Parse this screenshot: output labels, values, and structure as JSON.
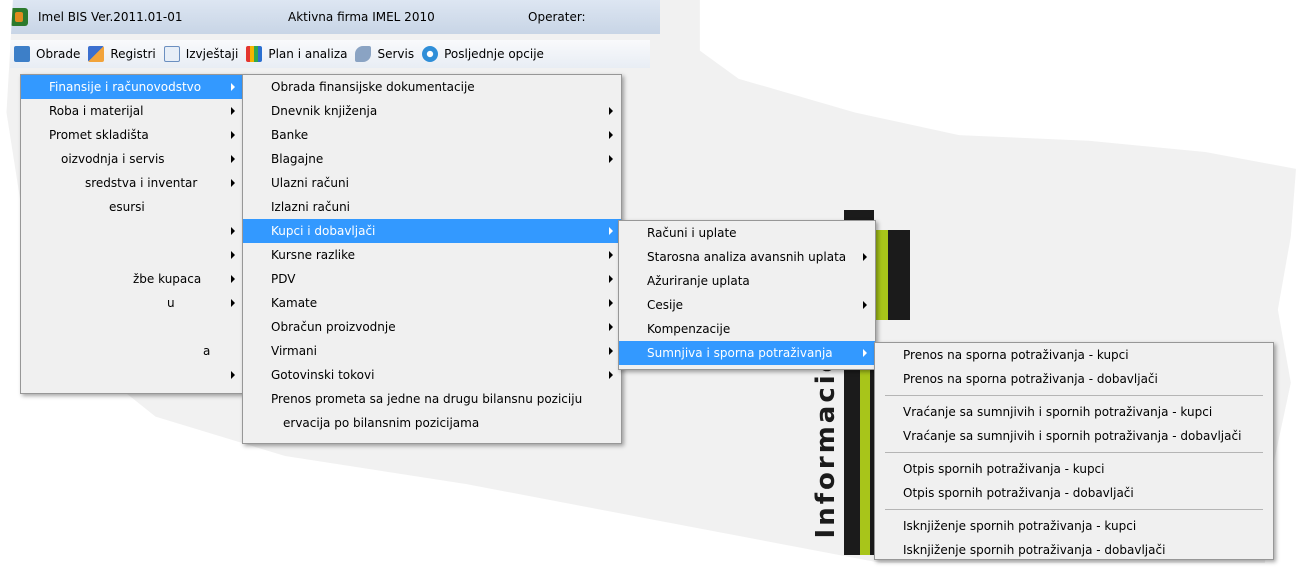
{
  "window": {
    "title": "Imel BIS Ver.2011.01-01",
    "company": "Aktivna firma IMEL 2010",
    "operator_label": "Operater:"
  },
  "menubar": [
    {
      "label": "Obrade",
      "icon": "document-icon"
    },
    {
      "label": "Registri",
      "icon": "pencil-icon"
    },
    {
      "label": "Izvještaji",
      "icon": "report-icon"
    },
    {
      "label": "Plan i analiza",
      "icon": "chart-icon"
    },
    {
      "label": "Servis",
      "icon": "wrench-icon"
    },
    {
      "label": "Posljednje opcije",
      "icon": "disc-icon"
    }
  ],
  "menu_level1": [
    {
      "label": "Finansije i računovodstvo",
      "highlighted": true
    },
    {
      "label": "Roba i materijal"
    },
    {
      "label": "Promet skladišta"
    },
    {
      "label": "oizvodnja i servis"
    },
    {
      "label": "sredstva i inventar"
    },
    {
      "label": "esursi"
    },
    {
      "label": ""
    },
    {
      "label": ""
    },
    {
      "label": "žbe kupaca"
    },
    {
      "label": "u"
    },
    {
      "label": ""
    },
    {
      "label": "a"
    },
    {
      "label": ""
    }
  ],
  "menu_level2": [
    {
      "label": "Obrada finansijske dokumentacije"
    },
    {
      "label": "Dnevnik knjiženja"
    },
    {
      "label": "Banke"
    },
    {
      "label": "Blagajne"
    },
    {
      "label": "Ulazni računi"
    },
    {
      "label": "Izlazni računi"
    },
    {
      "label": "Kupci i dobavljači",
      "highlighted": true
    },
    {
      "label": "Kursne razlike"
    },
    {
      "label": "PDV"
    },
    {
      "label": "Kamate"
    },
    {
      "label": "Obračun proizvodnje"
    },
    {
      "label": "Virmani"
    },
    {
      "label": "Gotovinski tokovi"
    },
    {
      "label": "Prenos prometa sa jedne na drugu bilansnu poziciju"
    },
    {
      "label": "ervacija po bilansnim pozicijama"
    }
  ],
  "menu_level3": [
    {
      "label": "Računi i uplate"
    },
    {
      "label": "Starosna analiza avansnih uplata"
    },
    {
      "label": "Ažuriranje uplata"
    },
    {
      "label": "Cesije"
    },
    {
      "label": "Kompenzacije"
    },
    {
      "label": "Sumnjiva i sporna potraživanja",
      "highlighted": true
    }
  ],
  "menu_level4": [
    {
      "label": "Prenos na sporna potraživanja - kupci"
    },
    {
      "label": "Prenos na sporna potraživanja - dobavljači"
    },
    {
      "label": "Vraćanje sa sumnjivih i spornih potraživanja - kupci"
    },
    {
      "label": "Vraćanje sa sumnjivih i spornih potraživanja - dobavljači"
    },
    {
      "label": "Otpis spornih potraživanja - kupci"
    },
    {
      "label": "Otpis spornih potraživanja - dobavljači"
    },
    {
      "label": "Isknjiženje spornih potraživanja - kupci"
    },
    {
      "label": "Isknjiženje spornih potraživanja - dobavljači"
    }
  ],
  "background": {
    "logo_text": "s Informacio"
  },
  "colors": {
    "highlight": "#3399ff",
    "logo_green": "#a8c51a",
    "logo_dark": "#1b1b1b"
  }
}
